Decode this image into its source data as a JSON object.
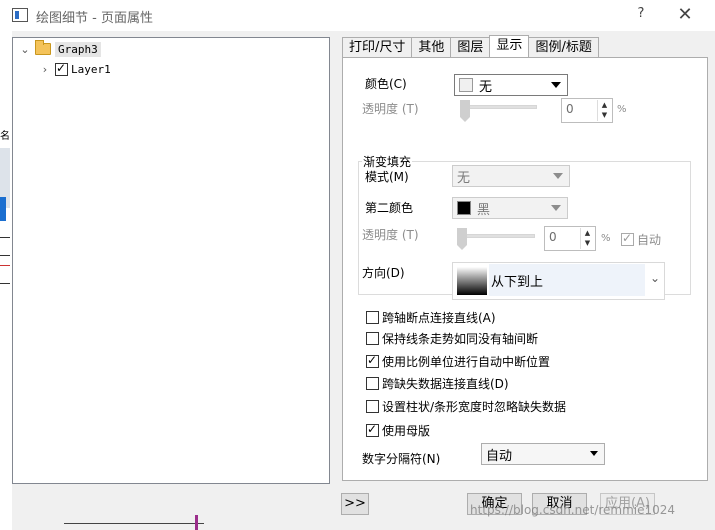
{
  "window": {
    "title": "绘图细节 - 页面属性",
    "help": "?",
    "close": "✕"
  },
  "tree": {
    "root": {
      "label": "Graph3",
      "expanded": true
    },
    "child": {
      "label": "Layer1",
      "checked": true
    }
  },
  "background": {
    "edge_char": "名"
  },
  "tabs": [
    "打印/尺寸",
    "其他",
    "图层",
    "显示",
    "图例/标题"
  ],
  "active_tab": "显示",
  "display": {
    "color": {
      "label": "颜色(C)",
      "value": "无",
      "swatch": "#f0f0f0"
    },
    "transparency": {
      "label": "透明度 (T)",
      "value": "0",
      "unit": "%"
    },
    "gradient": {
      "group_label": "渐变填充",
      "mode": {
        "label": "模式(M)",
        "value": "无"
      },
      "second_color": {
        "label": "第二颜色",
        "value": "黑",
        "swatch": "#000000"
      },
      "transparency": {
        "label": "透明度 (T)",
        "value": "0",
        "unit": "%",
        "auto_label": "自动",
        "auto_checked": true
      },
      "direction": {
        "label": "方向(D)",
        "value": "从下到上"
      }
    },
    "options": [
      {
        "label": "跨轴断点连接直线(A)",
        "checked": false
      },
      {
        "label": "保持线条走势如同没有轴间断",
        "checked": false
      },
      {
        "label": "使用比例单位进行自动中断位置",
        "checked": true
      },
      {
        "label": "跨缺失数据连接直线(D)",
        "checked": false
      },
      {
        "label": "设置柱状/条形宽度时忽略缺失数据",
        "checked": false
      },
      {
        "label": "使用母版",
        "checked": true
      }
    ],
    "digit_separator": {
      "label": "数字分隔符(N)",
      "value": "自动"
    }
  },
  "buttons": {
    "expand": ">>",
    "ok": "确定",
    "cancel": "取消",
    "apply": "应用(A)"
  },
  "watermark": "https://blog.csdn.net/remmie1024"
}
